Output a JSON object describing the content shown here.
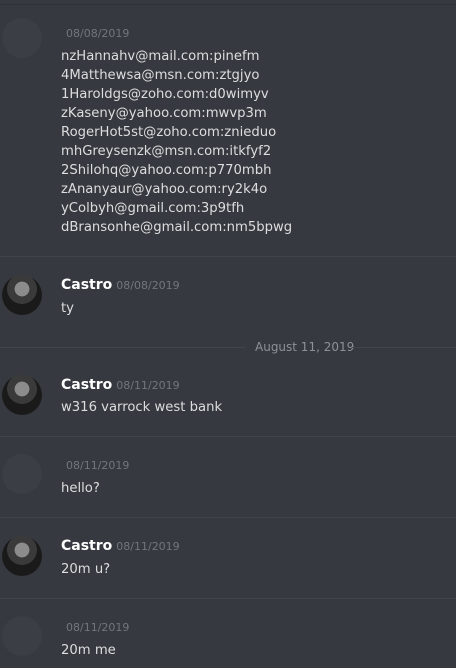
{
  "messages": {
    "m1": {
      "time": "08/08/2019",
      "lines": [
        "nzHannahv@mail.com:pinefm",
        "4Matthewsa@msn.com:ztgjyo",
        "1Haroldgs@zoho.com:d0wimyv",
        "zKaseny@yahoo.com:mwvp3m",
        "RogerHot5st@zoho.com:znieduo",
        "mhGreysenzk@msn.com:itkfyf2",
        "2Shilohq@yahoo.com:p770mbh",
        "zAnanyaur@yahoo.com:ry2k4o",
        "yColbyh@gmail.com:3p9tfh",
        "dBransonhe@gmail.com:nm5bpwg"
      ]
    },
    "m2": {
      "author": "Castro",
      "time": "08/08/2019",
      "text": "ty"
    },
    "date_separator": "August 11, 2019",
    "m3": {
      "author": "Castro",
      "time": "08/11/2019",
      "text": "w316 varrock west bank"
    },
    "m4": {
      "time": "08/11/2019",
      "text": "hello?"
    },
    "m5": {
      "author": "Castro",
      "time": "08/11/2019",
      "text": "20m u?"
    },
    "m6": {
      "time": "08/11/2019",
      "text": "20m me"
    }
  }
}
